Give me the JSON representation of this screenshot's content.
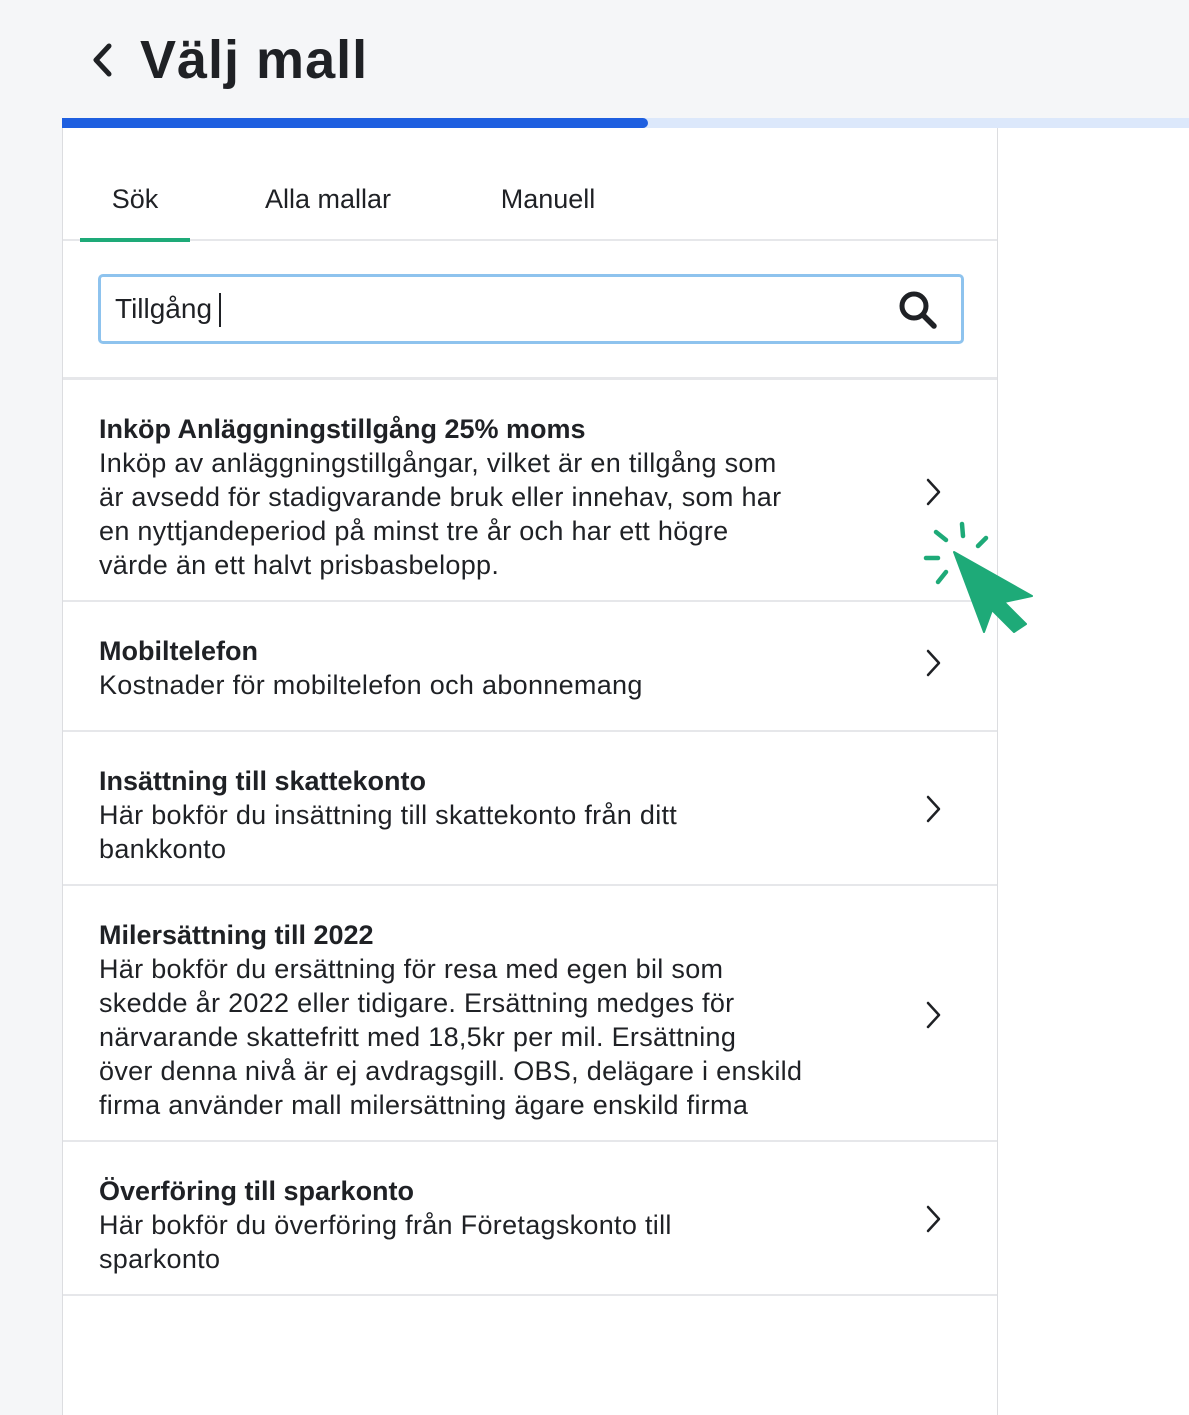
{
  "header": {
    "title": "Välj mall",
    "back_icon": "chevron-left-icon"
  },
  "progress": {
    "fraction": 0.52,
    "fill_color": "#1e5fe0",
    "track_color": "#dce8fb"
  },
  "tabs": [
    {
      "label": "Sök",
      "active": true
    },
    {
      "label": "Alla mallar",
      "active": false
    },
    {
      "label": "Manuell",
      "active": false
    }
  ],
  "search": {
    "value": "Tillgång",
    "icon": "search-icon"
  },
  "results": [
    {
      "title": "Inköp Anläggningstillgång 25% moms",
      "lines": [
        "Inköp av anläggningstillgångar, vilket är en tillgång som",
        "är avsedd för stadigvarande bruk eller innehav, som har",
        "en nyttjandeperiod på minst tre år och har ett högre",
        "värde än ett halvt prisbasbelopp."
      ]
    },
    {
      "title": "Mobiltelefon",
      "lines": [
        "Kostnader för mobiltelefon och abonnemang"
      ]
    },
    {
      "title": "Insättning till skattekonto",
      "lines": [
        "Här bokför du insättning till skattekonto från ditt",
        "bankkonto"
      ]
    },
    {
      "title": "Milersättning till 2022",
      "lines": [
        "Här bokför du ersättning för resa med egen bil som",
        "skedde år 2022 eller tidigare. Ersättning medges för",
        "närvarande skattefritt med 18,5kr per mil. Ersättning",
        "över denna nivå är ej avdragsgill. OBS, delägare i enskild",
        "firma använder mall milersättning ägare enskild firma"
      ]
    },
    {
      "title": "Överföring till sparkonto",
      "lines": [
        "Här bokför du överföring från Företagskonto till",
        "sparkonto"
      ]
    }
  ],
  "colors": {
    "accent_green": "#1eaa78",
    "search_border": "#8ec3ee"
  }
}
